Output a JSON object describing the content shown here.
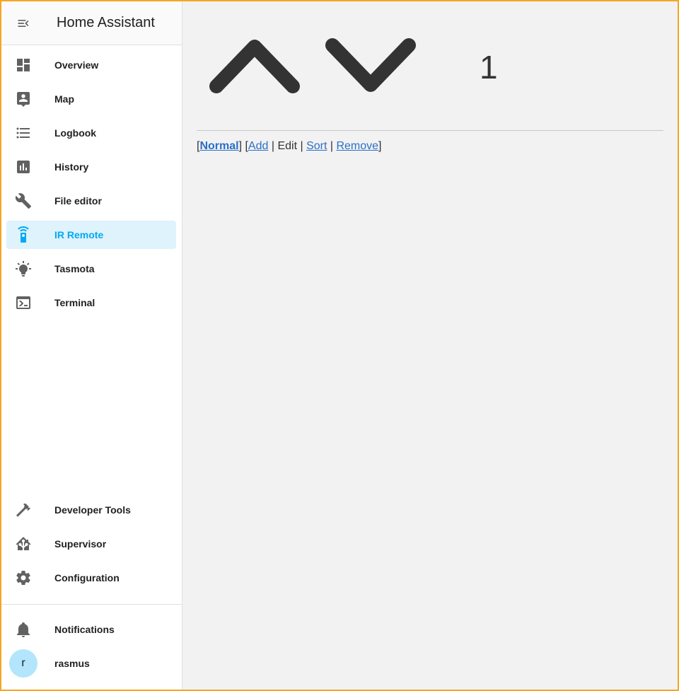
{
  "app": {
    "title": "Home Assistant"
  },
  "sidebar": {
    "items": [
      {
        "label": "Overview",
        "icon": "dashboard-icon"
      },
      {
        "label": "Map",
        "icon": "map-person-icon"
      },
      {
        "label": "Logbook",
        "icon": "list-icon"
      },
      {
        "label": "History",
        "icon": "chart-bar-icon"
      },
      {
        "label": "File editor",
        "icon": "wrench-icon"
      },
      {
        "label": "IR Remote",
        "icon": "remote-icon",
        "active": true
      },
      {
        "label": "Tasmota",
        "icon": "lightbulb-icon"
      },
      {
        "label": "Terminal",
        "icon": "console-icon"
      }
    ],
    "bottom_items": [
      {
        "label": "Developer Tools",
        "icon": "hammer-icon"
      },
      {
        "label": "Supervisor",
        "icon": "home-assistant-icon"
      },
      {
        "label": "Configuration",
        "icon": "gear-icon"
      }
    ],
    "notifications_label": "Notifications",
    "user": {
      "initial": "r",
      "name": "rasmus"
    }
  },
  "main": {
    "counter": "1",
    "modes": {
      "normal": "Normal",
      "add": "Add",
      "edit": "Edit",
      "sort": "Sort",
      "remove": "Remove"
    }
  },
  "colors": {
    "accent": "#03a9f4",
    "active_bg": "#def3fb",
    "icon": "#616161",
    "link": "#2a6fc9",
    "main_bg": "#f2f2f2",
    "frame": "#f5a623"
  }
}
